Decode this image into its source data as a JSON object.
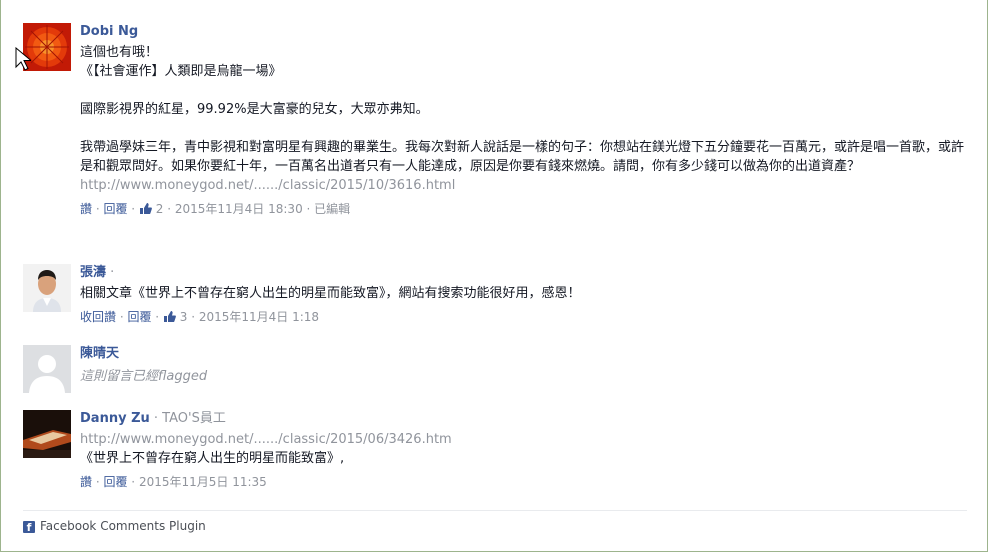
{
  "comments": [
    {
      "author": "Dobi Ng",
      "text": "這個也有哦！\n《【社會運作】人類即是烏龍一場》\n\n國際影視界的紅星，99.92%是大富豪的兒女，大眾亦弗知。\n\n我帶過學妹三年，青中影視和對富明星有興趣的畢業生。我每次對新人說話是一樣的句子：你想站在鎂光燈下五分鐘要花一百萬元，或許是唱一首歌，或許是和觀眾問好。如果你要紅十年，一百萬名出道者只有一人能達成，原因是你要有錢來燃燒。請問，你有多少錢可以做為你的出道資產？",
      "link": "http://www.moneygod.net/....../classic/2015/10/3616.html",
      "meta": {
        "like": "讚",
        "reply": "回覆",
        "likes": "2",
        "time": "2015年11月4日 18:30",
        "edited": "已編輯"
      }
    },
    {
      "author": "張濤",
      "text": "相關文章《世界上不曾存在窮人出生的明星而能致富》，網站有搜索功能很好用，感恩！",
      "meta": {
        "like": "收回讚",
        "reply": "回覆",
        "likes": "3",
        "time": "2015年11月4日 1:18"
      }
    },
    {
      "author": "陳晴天",
      "flag": "這則留言已經flagged"
    },
    {
      "author": "Danny Zu",
      "author_sub": "TAO'S員工",
      "link": "http://www.moneygod.net/....../classic/2015/06/3426.htm",
      "text": "《世界上不曾存在窮人出生的明星而能致富》,",
      "meta": {
        "like": "讚",
        "reply": "回覆",
        "time": "2015年11月5日 11:35"
      }
    }
  ],
  "footer": {
    "label": "Facebook Comments Plugin"
  },
  "colors": {
    "link": "#3b5998",
    "muted": "#90949c",
    "border": "#9db48d"
  }
}
